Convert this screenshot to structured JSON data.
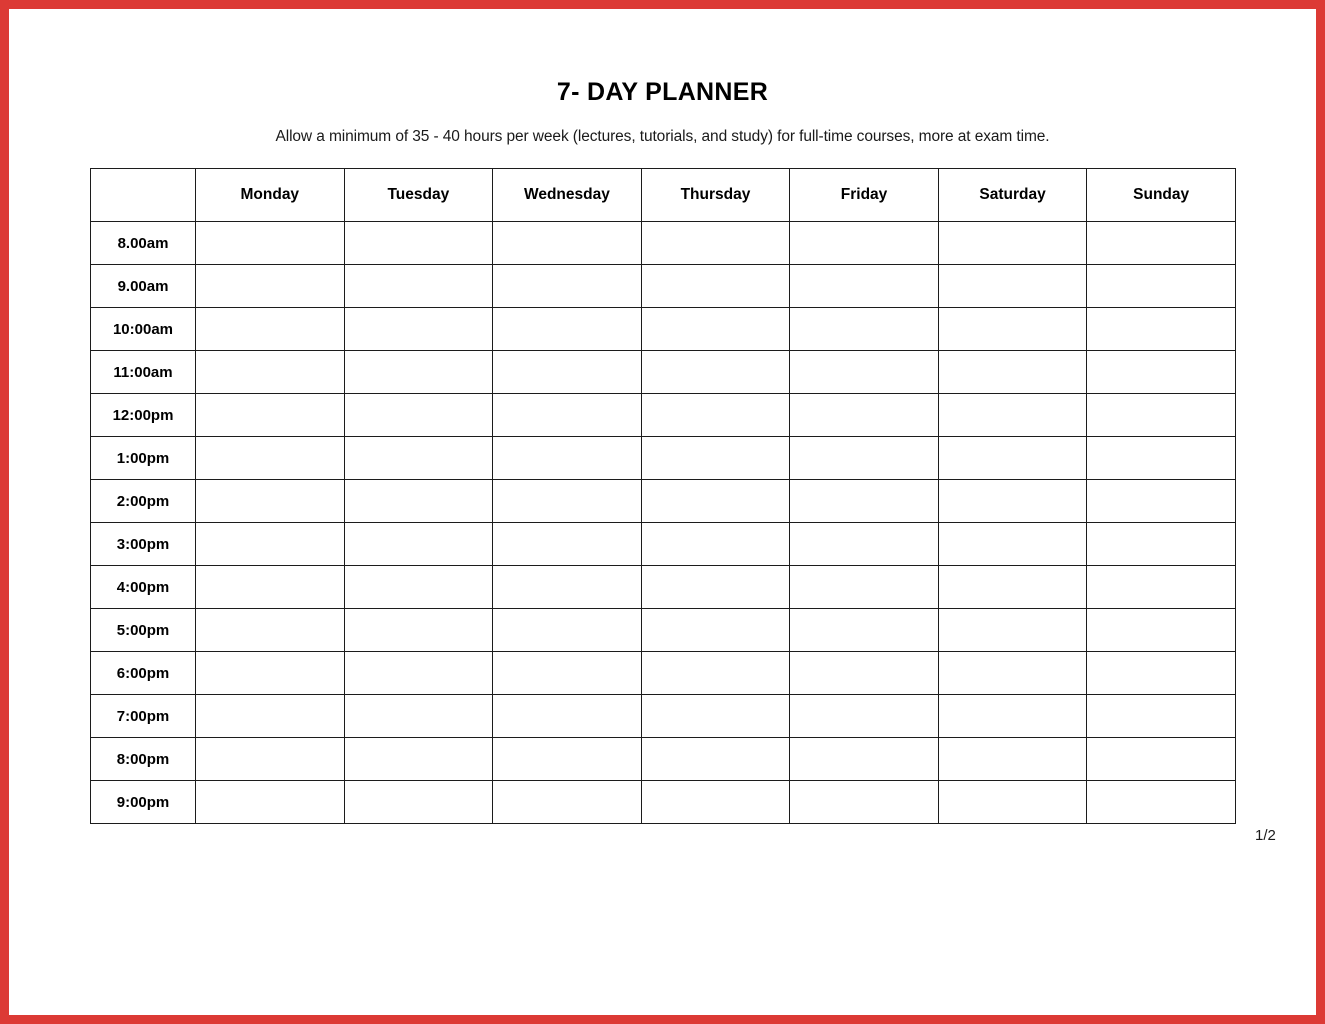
{
  "page": {
    "background_color": "#ffffff",
    "border_color": "#dc3a35",
    "page_indicator": "1/2"
  },
  "header": {
    "title": "7- DAY PLANNER",
    "subtitle": "Allow a minimum of 35 - 40 hours per week (lectures, tutorials, and study) for full-time courses, more at exam time."
  },
  "planner_table": {
    "corner_header": "",
    "day_headers": [
      "Monday",
      "Tuesday",
      "Wednesday",
      "Thursday",
      "Friday",
      "Saturday",
      "Sunday"
    ],
    "time_slots": [
      "8.00am",
      "9.00am",
      "10:00am",
      "11:00am",
      "12:00pm",
      "1:00pm",
      "2:00pm",
      "3:00pm",
      "4:00pm",
      "5:00pm",
      "6:00pm",
      "7:00pm",
      "8:00pm",
      "9:00pm"
    ],
    "cell_values": [
      [
        "",
        "",
        "",
        "",
        "",
        "",
        ""
      ],
      [
        "",
        "",
        "",
        "",
        "",
        "",
        ""
      ],
      [
        "",
        "",
        "",
        "",
        "",
        "",
        ""
      ],
      [
        "",
        "",
        "",
        "",
        "",
        "",
        ""
      ],
      [
        "",
        "",
        "",
        "",
        "",
        "",
        ""
      ],
      [
        "",
        "",
        "",
        "",
        "",
        "",
        ""
      ],
      [
        "",
        "",
        "",
        "",
        "",
        "",
        ""
      ],
      [
        "",
        "",
        "",
        "",
        "",
        "",
        ""
      ],
      [
        "",
        "",
        "",
        "",
        "",
        "",
        ""
      ],
      [
        "",
        "",
        "",
        "",
        "",
        "",
        ""
      ],
      [
        "",
        "",
        "",
        "",
        "",
        "",
        ""
      ],
      [
        "",
        "",
        "",
        "",
        "",
        "",
        ""
      ],
      [
        "",
        "",
        "",
        "",
        "",
        "",
        ""
      ],
      [
        "",
        "",
        "",
        "",
        "",
        "",
        ""
      ]
    ]
  }
}
